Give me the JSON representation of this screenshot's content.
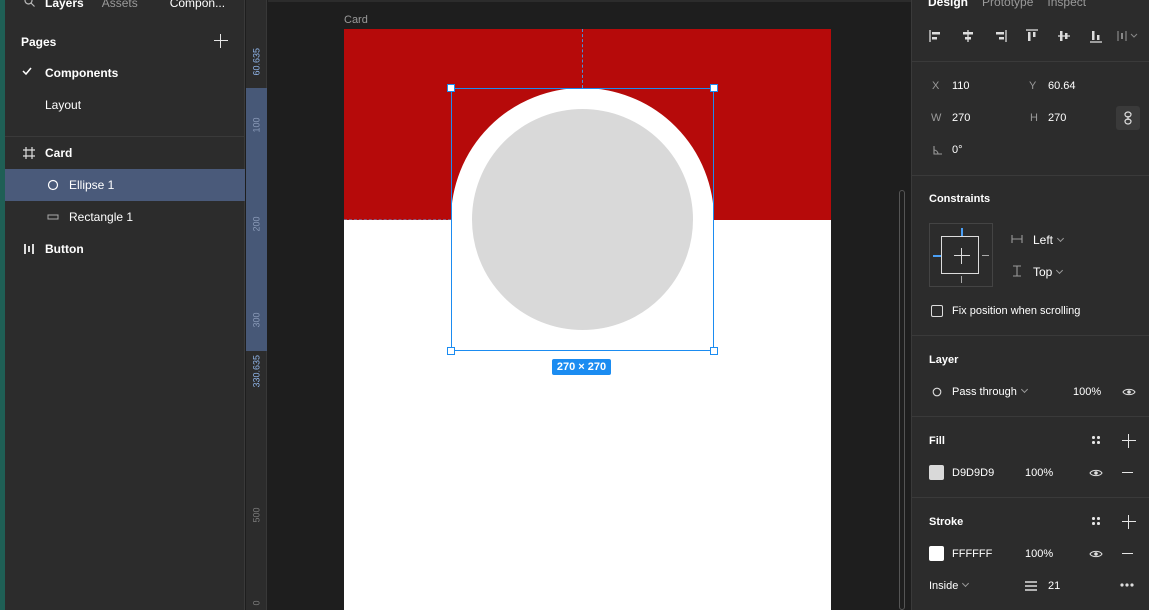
{
  "left_panel": {
    "tabs": [
      "Layers",
      "Assets",
      "Compon..."
    ],
    "pages_title": "Pages",
    "pages": [
      "Components",
      "Layout"
    ],
    "layers": [
      {
        "label": "Card",
        "icon": "frame-icon"
      },
      {
        "label": "Ellipse 1",
        "icon": "ellipse-icon"
      },
      {
        "label": "Rectangle 1",
        "icon": "rectangle-icon"
      },
      {
        "label": "Button",
        "icon": "auto-layout-icon"
      }
    ]
  },
  "ruler": {
    "ticks": [
      "60.635",
      "100",
      "200",
      "300",
      "330.635",
      "500",
      "0"
    ]
  },
  "canvas": {
    "frame_label": "Card",
    "size_badge": "270 × 270",
    "colors": {
      "red": "#b60a0a",
      "ellipse_fill": "#D9D9D9",
      "stroke": "#FFFFFF",
      "selection": "#1b8cf1"
    }
  },
  "right_panel": {
    "tabs": [
      "Design",
      "Prototype",
      "Inspect"
    ],
    "x_label": "X",
    "x_value": "110",
    "y_label": "Y",
    "y_value": "60.64",
    "w_label": "W",
    "w_value": "270",
    "h_label": "H",
    "h_value": "270",
    "rotation": "0°",
    "constraints_title": "Constraints",
    "constraint_h": "Left",
    "constraint_v": "Top",
    "fix_position": "Fix position when scrolling",
    "layer_title": "Layer",
    "blend_mode": "Pass through",
    "layer_opacity": "100%",
    "fill_title": "Fill",
    "fill_hex": "D9D9D9",
    "fill_opacity": "100%",
    "stroke_title": "Stroke",
    "stroke_hex": "FFFFFF",
    "stroke_opacity": "100%",
    "stroke_position": "Inside",
    "stroke_weight": "21"
  }
}
